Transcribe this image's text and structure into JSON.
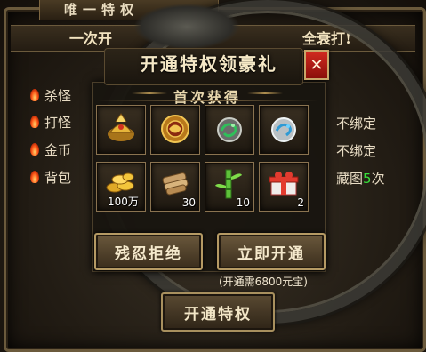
{
  "background": {
    "window_title": "唯一特权",
    "subheader_left": "一次开",
    "subheader_right": "全衰打!",
    "rows": [
      {
        "label": "杀怪",
        "right": ""
      },
      {
        "label": "打怪",
        "right": "不绑定"
      },
      {
        "label": "金币",
        "right": "不绑定"
      },
      {
        "label": "背包",
        "right_prefix": "藏图",
        "right_num": "5",
        "right_suffix": "次"
      }
    ],
    "bottom_button": "开通特权"
  },
  "dialog": {
    "title": "开通特权领豪礼",
    "close_label": "✕",
    "section_label": "首次获得",
    "items": [
      {
        "icon": "gold-helmet-icon",
        "count": ""
      },
      {
        "icon": "dragon-medal-icon",
        "count": ""
      },
      {
        "icon": "jade-dragon-icon",
        "count": ""
      },
      {
        "icon": "silver-dragon-icon",
        "count": ""
      },
      {
        "icon": "gold-coins-icon",
        "count": "100万"
      },
      {
        "icon": "scroll-bundle-icon",
        "count": "30"
      },
      {
        "icon": "bamboo-icon",
        "count": "10"
      },
      {
        "icon": "gift-box-icon",
        "count": "2"
      }
    ],
    "reject_button": "残忍拒绝",
    "open_button": "立即开通",
    "cost_note": "(开通需6800元宝)"
  },
  "colors": {
    "accent_gold": "#b59a64",
    "close_red": "#c8231b",
    "highlight_green": "#37e13a"
  }
}
